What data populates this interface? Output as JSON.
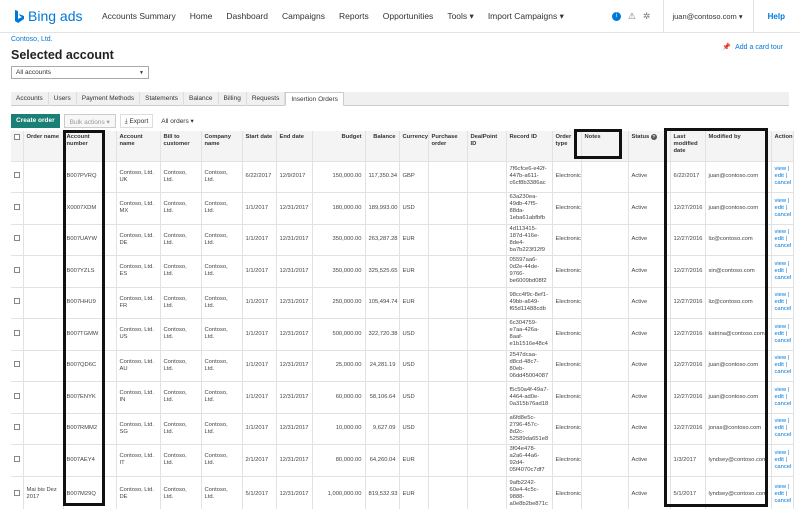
{
  "nav": {
    "logo_text": "Bing ads",
    "links": [
      "Accounts Summary",
      "Home",
      "Dashboard",
      "Campaigns",
      "Reports",
      "Opportunities",
      "Tools",
      "Import Campaigns"
    ],
    "tools_caret": "▾",
    "import_caret": "▾",
    "info_icon": "i",
    "warning_icon": "⚠",
    "tips_icon": "✲",
    "user_email": "juan@contoso.com",
    "user_caret": "▾",
    "help_label": "Help"
  },
  "header": {
    "breadcrumb": "Contoso, Ltd.",
    "title": "Selected account",
    "card_tour": "Add a card tour",
    "account_select": "All accounts"
  },
  "tabs": [
    "Accounts",
    "Users",
    "Payment Methods",
    "Statements",
    "Balance",
    "Billing",
    "Requests",
    "Insertion Orders"
  ],
  "toolbar": {
    "create_order": "Create order",
    "bulk_actions": "Bulk actions",
    "export": "Export",
    "all_orders": "All orders"
  },
  "columns": [
    "Order name",
    "Account number",
    "Account name",
    "Bill to customer",
    "Company name",
    "Start date",
    "End date",
    "Budget",
    "Balance",
    "Currency",
    "Purchase order",
    "DealPoint ID",
    "Record ID",
    "Order type",
    "Notes",
    "Status",
    "Last modified date",
    "Modified by",
    "Action"
  ],
  "status_help_icon": "?",
  "rows": [
    {
      "order": "",
      "acct": "B007PVRQ",
      "name": "Contoso, Ltd. UK",
      "bill": "Contoso, Ltd.",
      "company": "Contoso, Ltd.",
      "start": "6/22/2017",
      "end": "12/9/2017",
      "budget": "150,000.00",
      "balance": "117,350.34",
      "currency": "GBP",
      "record": "7f6cfce6-e42f-447b-a611-c6cf8b3386ac",
      "type": "Electronic",
      "status": "Active",
      "modified": "6/22/2017",
      "by": "juan@contoso.com",
      "action": "view | edit | cancel"
    },
    {
      "order": "",
      "acct": "X0007XDM",
      "name": "Contoso, Ltd. MX",
      "bill": "Contoso, Ltd.",
      "company": "Contoso, Ltd.",
      "start": "1/1/2017",
      "end": "12/31/2017",
      "budget": "180,000.00",
      "balance": "189,993.00",
      "currency": "USD",
      "record": "63a230ea-49db-47f5-88da-1eba61abfbfb",
      "type": "Electronic",
      "status": "Active",
      "modified": "12/27/2016",
      "by": "juan@contoso.com",
      "action": "view | edit | cancel"
    },
    {
      "order": "",
      "acct": "B007UAYW",
      "name": "Contoso, Ltd. DE",
      "bill": "Contoso, Ltd.",
      "company": "Contoso, Ltd.",
      "start": "1/1/2017",
      "end": "12/31/2017",
      "budget": "350,000.00",
      "balance": "263,287.28",
      "currency": "EUR",
      "record": "4d113415-187d-416e-8de4-ba7b223f12f9",
      "type": "Electronic",
      "status": "Active",
      "modified": "12/27/2016",
      "by": "liz@contoso.com",
      "action": "view | edit | cancel"
    },
    {
      "order": "",
      "acct": "B007YZLS",
      "name": "Contoso, Ltd. ES",
      "bill": "Contoso, Ltd.",
      "company": "Contoso, Ltd.",
      "start": "1/1/2017",
      "end": "12/31/2017",
      "budget": "350,000.00",
      "balance": "325,525.65",
      "currency": "EUR",
      "record": "05597aa6-0d2e-44de-9766-be6009bd08f2",
      "type": "Electronic",
      "status": "Active",
      "modified": "12/27/2016",
      "by": "xin@contoso.com",
      "action": "view | edit | cancel"
    },
    {
      "order": "",
      "acct": "B007HHU9",
      "name": "Contoso, Ltd. FR",
      "bill": "Contoso, Ltd.",
      "company": "Contoso, Ltd.",
      "start": "1/1/2017",
      "end": "12/31/2017",
      "budget": "250,000.00",
      "balance": "105,494.74",
      "currency": "EUR",
      "record": "98cc4f9c-8ef1-49bb-a649-f65d11488cdb",
      "type": "Electronic",
      "status": "Active",
      "modified": "12/27/2016",
      "by": "liz@contoso.com",
      "action": "view | edit | cancel"
    },
    {
      "order": "",
      "acct": "B007TGMW",
      "name": "Contoso, Ltd. US",
      "bill": "Contoso, Ltd.",
      "company": "Contoso, Ltd.",
      "start": "1/1/2017",
      "end": "12/31/2017",
      "budget": "500,000.00",
      "balance": "322,720.38",
      "currency": "USD",
      "record": "6c304759-e7aa-426a-8aaf-e1b1516e48c4",
      "type": "Electronic",
      "status": "Active",
      "modified": "12/27/2016",
      "by": "katrina@contoso.com",
      "action": "view | edit | cancel"
    },
    {
      "order": "",
      "acct": "B007QD6C",
      "name": "Contoso, Ltd. AU",
      "bill": "Contoso, Ltd.",
      "company": "Contoso, Ltd.",
      "start": "1/1/2017",
      "end": "12/31/2017",
      "budget": "25,000.00",
      "balance": "24,281.19",
      "currency": "USD",
      "record": "2547dcaa-d8cd-48c7-80eb-06dd45004087",
      "type": "Electronic",
      "status": "Active",
      "modified": "12/27/2016",
      "by": "juan@contoso.com",
      "action": "view | edit | cancel"
    },
    {
      "order": "",
      "acct": "B007ENYK",
      "name": "Contoso, Ltd. IN",
      "bill": "Contoso, Ltd.",
      "company": "Contoso, Ltd.",
      "start": "1/1/2017",
      "end": "12/31/2017",
      "budget": "60,000.00",
      "balance": "58,106.64",
      "currency": "USD",
      "record": "f5c50a4f-49a7-4464-ad0e-0a315b76ad18",
      "type": "Electronic",
      "status": "Active",
      "modified": "12/27/2016",
      "by": "juan@contoso.com",
      "action": "view | edit | cancel"
    },
    {
      "order": "",
      "acct": "B007RMM2",
      "name": "Contoso, Ltd. SG",
      "bill": "Contoso, Ltd.",
      "company": "Contoso, Ltd.",
      "start": "1/1/2017",
      "end": "12/31/2017",
      "budget": "10,000.00",
      "balance": "9,627.09",
      "currency": "USD",
      "record": "a6fd8e5c-2796-457c-8d2c-52589da651e8",
      "type": "Electronic",
      "status": "Active",
      "modified": "12/27/2016",
      "by": "jonas@contoso.com",
      "action": "view | edit | cancel"
    },
    {
      "order": "",
      "acct": "B007AEY4",
      "name": "Contoso, Ltd. IT",
      "bill": "Contoso, Ltd.",
      "company": "Contoso, Ltd.",
      "start": "2/1/2017",
      "end": "12/31/2017",
      "budget": "80,000.00",
      "balance": "64,260.04",
      "currency": "EUR",
      "record": "3f04e478-a2a6-44a6-92d4-05f4070c7df7",
      "type": "Electronic",
      "status": "Active",
      "modified": "1/3/2017",
      "by": "lyndsey@contoso.com",
      "action": "view | edit | cancel"
    },
    {
      "order": "Mai bis Dez 2017",
      "acct": "B007M29Q",
      "name": "Contoso, Ltd. DE",
      "bill": "Contoso, Ltd.",
      "company": "Contoso, Ltd.",
      "start": "5/1/2017",
      "end": "12/31/2017",
      "budget": "1,000,000.00",
      "balance": "819,532.93",
      "currency": "EUR",
      "record": "9afb2242-60e4-4c5c-9888-a0e8b2be871c",
      "type": "Electronic",
      "status": "Active",
      "modified": "5/1/2017",
      "by": "lyndsey@contoso.com",
      "action": "view | edit | cancel"
    }
  ],
  "colors": {
    "brand": "#0078d7",
    "primary_button": "#1a7f74",
    "highlight": "#111111"
  }
}
